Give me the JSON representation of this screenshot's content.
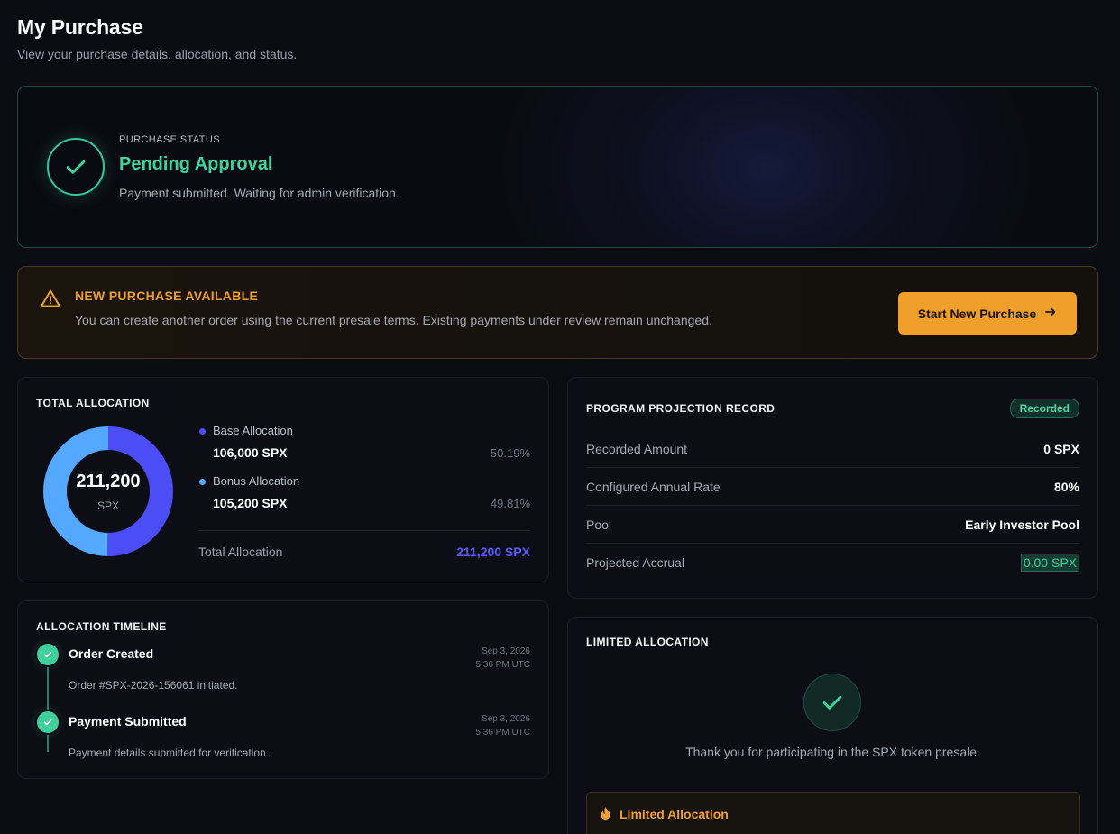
{
  "header": {
    "title": "My Purchase",
    "subtitle": "View your purchase details, allocation, and status."
  },
  "status": {
    "eyebrow": "PURCHASE STATUS",
    "title": "Pending Approval",
    "description": "Payment submitted. Waiting for admin verification."
  },
  "notice": {
    "title": "NEW PURCHASE AVAILABLE",
    "description": "You can create another order using the current presale terms. Existing payments under review remain unchanged.",
    "button_label": "Start New Purchase"
  },
  "allocation": {
    "title": "TOTAL ALLOCATION",
    "donut_value": "211,200",
    "donut_unit": "SPX",
    "items": [
      {
        "label": "Base Allocation",
        "value": "106,000 SPX",
        "percent": "50.19%",
        "share": 0.5019,
        "color": "#4d4df5"
      },
      {
        "label": "Bonus Allocation",
        "value": "105,200 SPX",
        "percent": "49.81%",
        "share": 0.4981,
        "color": "#54a8ff"
      }
    ],
    "total_label": "Total Allocation",
    "total_value": "211,200 SPX"
  },
  "timeline": {
    "title": "ALLOCATION TIMELINE",
    "events": [
      {
        "title": "Order Created",
        "description": "Order #SPX-2026-156061 initiated.",
        "date": "Sep 3, 2026",
        "time": "5:36 PM UTC"
      },
      {
        "title": "Payment Submitted",
        "description": "Payment details submitted for verification.",
        "date": "Sep 3, 2026",
        "time": "5:36 PM UTC"
      }
    ]
  },
  "projection": {
    "title": "PROGRAM PROJECTION RECORD",
    "badge": "Recorded",
    "rows": [
      {
        "label": "Recorded Amount",
        "value": "0 SPX"
      },
      {
        "label": "Configured Annual Rate",
        "value": "80%"
      },
      {
        "label": "Pool",
        "value": "Early Investor Pool"
      },
      {
        "label": "Projected Accrual",
        "value": "0.00 SPX"
      }
    ]
  },
  "limited": {
    "title": "LIMITED ALLOCATION",
    "message": "Thank you for participating in the SPX token presale.",
    "box_title": "Limited Allocation"
  },
  "colors": {
    "accent_green": "#3fd39e",
    "accent_orange": "#f0a02a",
    "accent_indigo": "#5b5cf6"
  },
  "icons": {
    "status": "check-icon",
    "notice": "warning-triangle-icon",
    "button": "arrow-right-icon",
    "limited": "fire-icon"
  }
}
